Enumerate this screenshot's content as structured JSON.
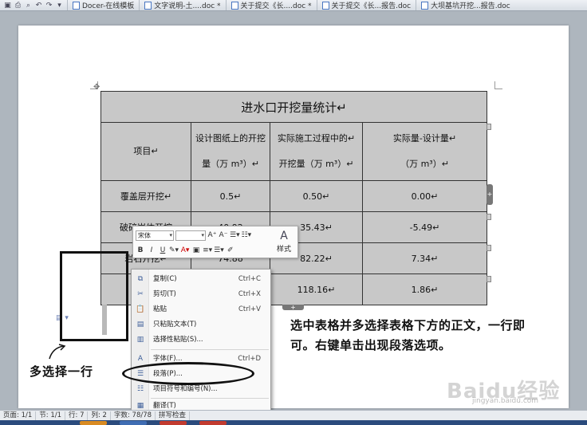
{
  "tabbar": {
    "tabs": [
      {
        "label": "Docer-在线模板"
      },
      {
        "label": "文字说明-土....doc *"
      },
      {
        "label": "关于提交《长....doc *"
      },
      {
        "label": "关于提交《长...报告.doc"
      },
      {
        "label": "大坝基坑开挖...报告.doc"
      }
    ]
  },
  "table": {
    "title": "进水口开挖量统计↵",
    "headers": [
      {
        "line1": "项目↵",
        "line2": ""
      },
      {
        "line1": "设计图纸上的开挖",
        "line2": "量（万 m³）↵"
      },
      {
        "line1": "实际施工过程中的↵",
        "line2": "开挖量（万 m³）↵"
      },
      {
        "line1": "实际量-设计量↵",
        "line2": "（万 m³）↵"
      }
    ],
    "rows": [
      [
        "覆盖层开挖↵",
        "0.5↵",
        "0.50↵",
        "0.00↵"
      ],
      [
        "破碎岩体开挖",
        "40.92",
        "35.43↵",
        "-5.49↵"
      ],
      [
        "岩石开挖↵",
        "74.88",
        "82.22↵",
        "7.34↵"
      ],
      [
        "",
        "",
        "118.16↵",
        "1.86↵"
      ]
    ]
  },
  "mini_toolbar": {
    "font_name": "宋体",
    "font_size": "",
    "grow": "A⁺",
    "shrink": "A⁻",
    "bold": "B",
    "italic": "I",
    "underline": "U",
    "style_label": "样式"
  },
  "context_menu": {
    "items": [
      {
        "label": "复制(C)",
        "shortcut": "Ctrl+C",
        "icon": "copy-icon"
      },
      {
        "label": "剪切(T)",
        "shortcut": "Ctrl+X",
        "icon": "scissors-icon"
      },
      {
        "label": "粘贴",
        "shortcut": "Ctrl+V",
        "icon": "paste-icon"
      },
      {
        "label": "只粘贴文本(T)",
        "shortcut": "",
        "icon": "paste-text-icon"
      },
      {
        "label": "选择性粘贴(S)...",
        "shortcut": "",
        "icon": "paste-special-icon"
      },
      {
        "label": "字体(F)...",
        "shortcut": "Ctrl+D",
        "icon": "font-icon"
      },
      {
        "label": "段落(P)...",
        "shortcut": "",
        "icon": "paragraph-icon"
      },
      {
        "label": "项目符号和编号(N)...",
        "shortcut": "",
        "icon": "bullets-icon"
      },
      {
        "label": "翻译(T)",
        "shortcut": "",
        "icon": "translate-icon"
      }
    ]
  },
  "annotations": {
    "left_note": "多选择一行",
    "right_note": "选中表格并多选择表格下方的正文，一行即可。右键单击出现段落选项。"
  },
  "status_bar": {
    "page": "页面: 1/1",
    "section": "节: 1/1",
    "row": "行: 7",
    "col": "列: 2",
    "chars": "字数: 78/78",
    "spell": "拼写检查"
  },
  "watermark": {
    "brand": "Baidu经验",
    "url": "jingyan.baidu.com"
  },
  "colors": {
    "table_fill": "#c8c8c8",
    "page": "#ffffff",
    "background": "#aeb6be",
    "annotation": "#111111"
  }
}
